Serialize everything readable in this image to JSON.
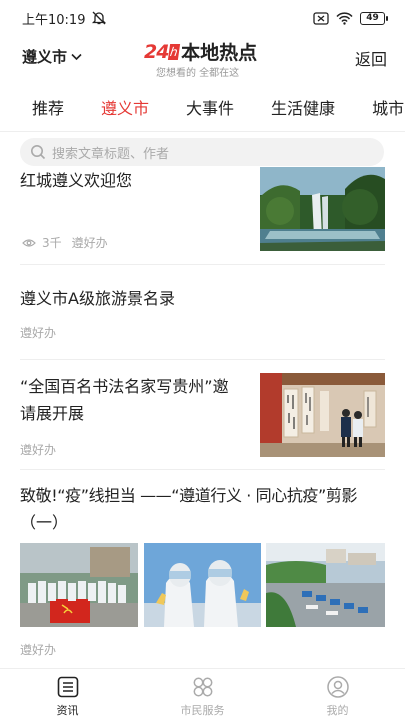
{
  "status_bar": {
    "time": "上午10:19",
    "battery": "49"
  },
  "header": {
    "city": "遵义市",
    "logo_num": "24",
    "logo_box": "h",
    "logo_title": "本地热点",
    "logo_sub": "您想看的 全都在这",
    "back": "返回"
  },
  "tabs": [
    "推荐",
    "遵义市",
    "大事件",
    "生活健康",
    "城市"
  ],
  "search": {
    "placeholder": "搜索文章标题、作者"
  },
  "articles": [
    {
      "title": "红城遵义欢迎您",
      "views": "3千",
      "source": "遵好办"
    },
    {
      "title": "遵义市A级旅游景名录",
      "source": "遵好办"
    },
    {
      "title_line1": "“全国百名书法名家写贵州”邀",
      "title_line2": "请展开展",
      "source": "遵好办"
    },
    {
      "title_line1": "致敬!“疫”线担当 ——“遵道行义 · 同心抗疫”剪影",
      "title_line2": "（一）",
      "source": "遵好办"
    }
  ],
  "bottom_nav": [
    {
      "label": "资讯",
      "icon": "news-icon"
    },
    {
      "label": "市民服务",
      "icon": "services-icon"
    },
    {
      "label": "我的",
      "icon": "profile-icon"
    }
  ],
  "colors": {
    "accent": "#e53935",
    "text": "#222222",
    "muted": "#aaaaaa"
  }
}
